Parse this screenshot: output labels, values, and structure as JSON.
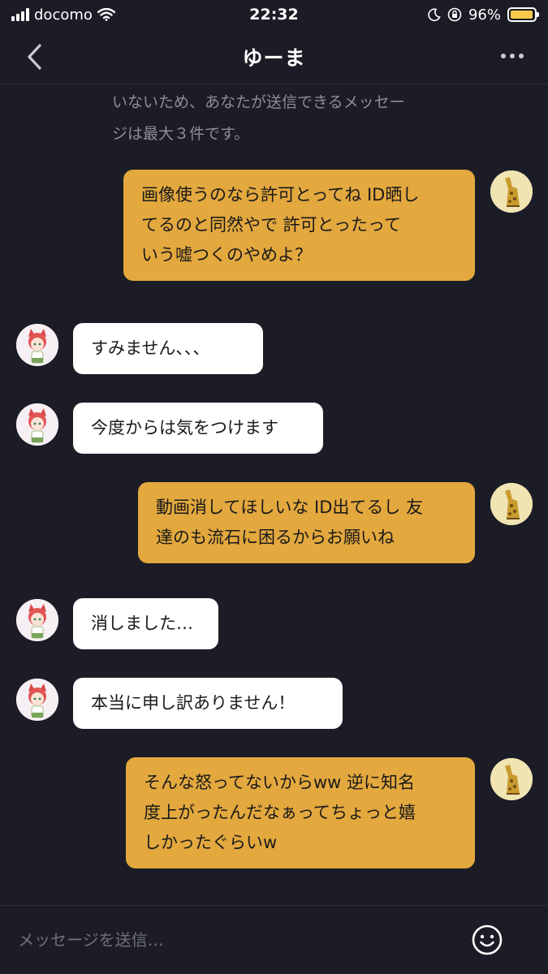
{
  "status_bar": {
    "carrier": "docomo",
    "time": "22:32",
    "battery_percent": "96%",
    "battery_level": 0.96
  },
  "header": {
    "title": "ゆーま"
  },
  "notice": {
    "line1": "いないため、あなたが送信できるメッセー",
    "line2": "ジは最大３件です。"
  },
  "messages": [
    {
      "sender": "me",
      "lines": [
        "画像使うのなら許可とってね ID晒し",
        "てるのと同然やで 許可とったって",
        "いう嘘つくのやめよ？"
      ]
    },
    {
      "sender": "them",
      "lines": [
        "すみません、、、"
      ]
    },
    {
      "sender": "them",
      "lines": [
        "今度からは気をつけます"
      ]
    },
    {
      "sender": "me",
      "lines": [
        "動画消してほしいな ID出てるし 友",
        "達のも流石に困るからお願いね"
      ]
    },
    {
      "sender": "them",
      "lines": [
        "消しました…"
      ]
    },
    {
      "sender": "them",
      "lines": [
        "本当に申し訳ありません！"
      ]
    },
    {
      "sender": "me",
      "lines": [
        "そんな怒ってないからww 逆に知名",
        "度上がったんだなぁってちょっと嬉",
        "しかったぐらいw"
      ]
    }
  ],
  "input": {
    "placeholder": "メッセージを送信…"
  },
  "colors": {
    "background": "#1b1c26",
    "outgoing_bubble": "#e3a83e",
    "incoming_bubble": "#ffffff",
    "battery": "#f7c84a"
  },
  "icons": {
    "back": "chevron-left-icon",
    "more": "ellipsis-icon",
    "emoji": "smiley-icon",
    "wifi": "wifi-icon",
    "moon": "moon-icon",
    "rotation_lock": "rotation-lock-icon"
  }
}
